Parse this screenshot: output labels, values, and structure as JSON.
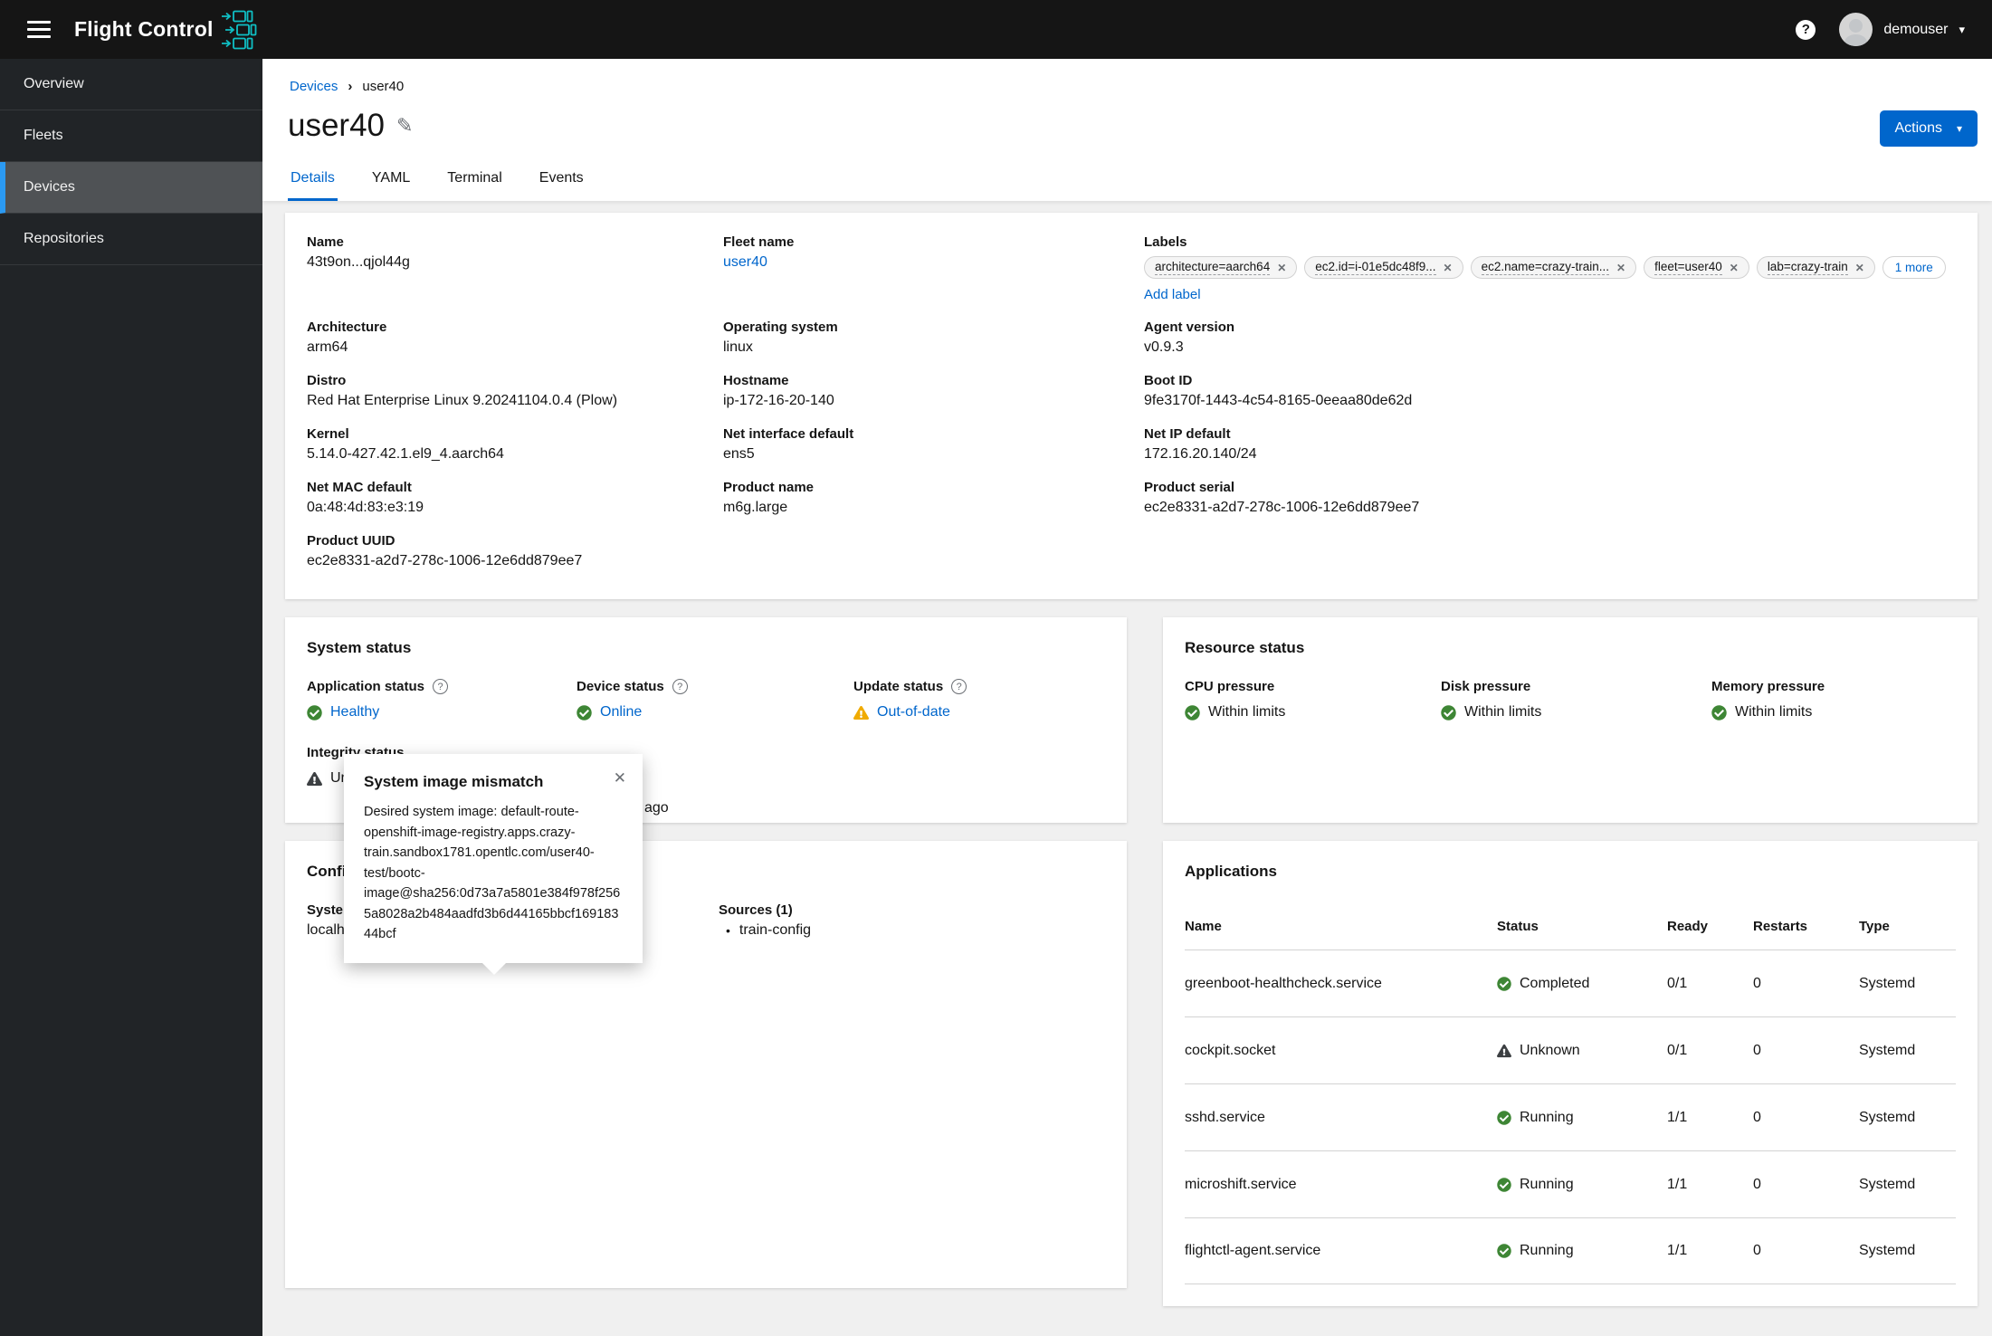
{
  "icons": {
    "help": "?",
    "close": "✕",
    "caret_down": "▾",
    "breadcrumb_separator": "›",
    "edit": "✎",
    "bullet": "•"
  },
  "colors": {
    "primary": "#0066cc",
    "success_green": "#3e8635",
    "warning_orange": "#f0ab00",
    "masthead_bg": "#151515",
    "sidebar_bg": "#212427",
    "content_bg": "#f0f0f0"
  },
  "masthead": {
    "brand": "Flight Control",
    "user": "demouser"
  },
  "sidebar": {
    "items": [
      {
        "label": "Overview"
      },
      {
        "label": "Fleets"
      },
      {
        "label": "Devices",
        "active": true
      },
      {
        "label": "Repositories"
      }
    ]
  },
  "breadcrumb": {
    "link": "Devices",
    "current": "user40"
  },
  "page": {
    "title": "user40",
    "actions_label": "Actions"
  },
  "tabs": [
    {
      "label": "Details",
      "active": true
    },
    {
      "label": "YAML"
    },
    {
      "label": "Terminal"
    },
    {
      "label": "Events"
    }
  ],
  "details": {
    "columns": [
      {
        "fields": [
          {
            "label": "Name",
            "value": "43t9on...qjol44g"
          },
          {
            "label": "Architecture",
            "value": "arm64"
          },
          {
            "label": "Distro",
            "value": "Red Hat Enterprise Linux 9.20241104.0.4 (Plow)"
          },
          {
            "label": "Kernel",
            "value": "5.14.0-427.42.1.el9_4.aarch64"
          },
          {
            "label": "Net MAC default",
            "value": "0a:48:4d:83:e3:19"
          },
          {
            "label": "Product UUID",
            "value": "ec2e8331-a2d7-278c-1006-12e6dd879ee7"
          }
        ]
      },
      {
        "fields": [
          {
            "label": "Fleet name",
            "value": "user40",
            "link": true
          },
          {
            "label": "Operating system",
            "value": "linux"
          },
          {
            "label": "Hostname",
            "value": "ip-172-16-20-140"
          },
          {
            "label": "Net interface default",
            "value": "ens5"
          },
          {
            "label": "Product name",
            "value": "m6g.large"
          }
        ]
      },
      {
        "fields": [
          {
            "label": "Agent version",
            "value": "v0.9.3"
          },
          {
            "label": "Boot ID",
            "value": "9fe3170f-1443-4c54-8165-0eeaa80de62d"
          },
          {
            "label": "Net IP default",
            "value": "172.16.20.140/24"
          },
          {
            "label": "Product serial",
            "value": "ec2e8331-a2d7-278c-1006-12e6dd879ee7"
          }
        ]
      }
    ],
    "labels_field": {
      "label": "Labels",
      "chips": [
        "architecture=aarch64",
        "ec2.id=i-01e5dc48f9...",
        "ec2.name=crazy-train...",
        "fleet=user40",
        "lab=crazy-train"
      ],
      "more_label": "1 more",
      "add_label": "Add label"
    }
  },
  "system_status": {
    "title": "System status",
    "items": [
      {
        "label": "Application status",
        "value": "Healthy",
        "status_icon": "check-circle"
      },
      {
        "label": "Device status",
        "value": "Online",
        "status_icon": "check-circle"
      },
      {
        "label": "Update status",
        "value": "Out-of-date",
        "status_icon": "warning-triangle"
      }
    ],
    "integrity": {
      "label": "Integrity status",
      "value": "Unknown",
      "status_icon": "unknown-triangle"
    },
    "occluded_fragment": "ago"
  },
  "popover": {
    "title": "System image mismatch",
    "body": "Desired system image: default-route-openshift-image-registry.apps.crazy-train.sandbox1781.opentlc.com/user40-test/bootc-image@sha256:0d73a7a5801e384f978f2565a8028a2b484aadfd3b6d44165bbcf16918344bcf"
  },
  "config": {
    "title": "Configurations",
    "system_image_label": "System image (running)",
    "system_image_value": "localhost/edge-device:latest",
    "sources_label": "Sources (1)",
    "sources": [
      "train-config"
    ]
  },
  "resource_status": {
    "title": "Resource status",
    "items": [
      {
        "label": "CPU pressure",
        "value": "Within limits",
        "status_icon": "check-circle"
      },
      {
        "label": "Disk pressure",
        "value": "Within limits",
        "status_icon": "check-circle"
      },
      {
        "label": "Memory pressure",
        "value": "Within limits",
        "status_icon": "check-circle"
      }
    ]
  },
  "applications": {
    "title": "Applications",
    "columns": [
      "Name",
      "Status",
      "Ready",
      "Restarts",
      "Type"
    ],
    "rows": [
      {
        "name": "greenboot-healthcheck.service",
        "status": "Completed",
        "status_icon": "check-circle",
        "ready": "0/1",
        "restarts": "0",
        "type": "Systemd"
      },
      {
        "name": "cockpit.socket",
        "status": "Unknown",
        "status_icon": "unknown-triangle",
        "ready": "0/1",
        "restarts": "0",
        "type": "Systemd"
      },
      {
        "name": "sshd.service",
        "status": "Running",
        "status_icon": "check-circle",
        "ready": "1/1",
        "restarts": "0",
        "type": "Systemd"
      },
      {
        "name": "microshift.service",
        "status": "Running",
        "status_icon": "check-circle",
        "ready": "1/1",
        "restarts": "0",
        "type": "Systemd"
      },
      {
        "name": "flightctl-agent.service",
        "status": "Running",
        "status_icon": "check-circle",
        "ready": "1/1",
        "restarts": "0",
        "type": "Systemd"
      }
    ]
  }
}
